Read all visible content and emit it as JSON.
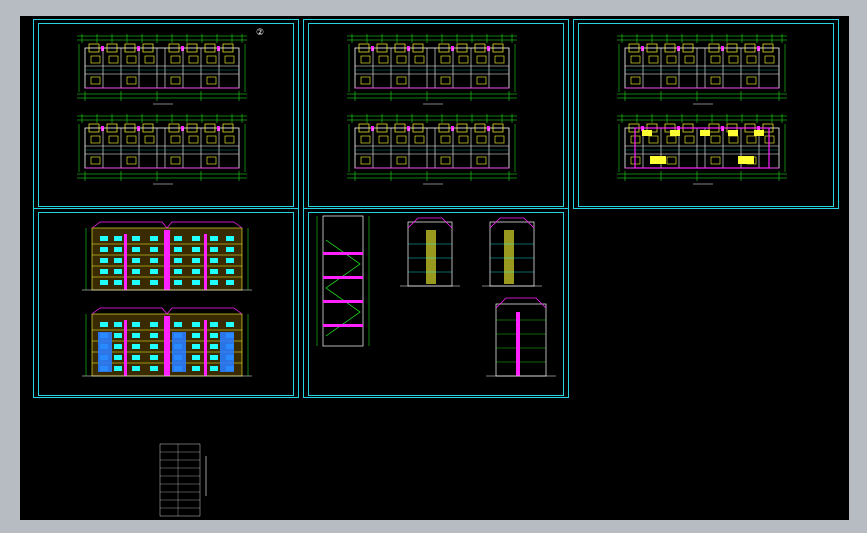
{
  "sheets": [
    {
      "id": "floor-plans-1",
      "kind": "plans"
    },
    {
      "id": "floor-plans-2",
      "kind": "plans"
    },
    {
      "id": "floor-plans-3",
      "kind": "plans"
    },
    {
      "id": "elevations",
      "kind": "elevations"
    },
    {
      "id": "sections",
      "kind": "sections"
    }
  ],
  "colors": {
    "background": "#000000",
    "frame": "#27d3e0",
    "wall": "#ffffff",
    "dimension": "#22ff22",
    "accent_yellow": "#ffff33",
    "accent_magenta": "#ff22ff",
    "accent_cyan": "#22ffff",
    "window_blue": "#2a7dff",
    "app_chrome": "#b7bcc3"
  },
  "drawing_marker": "②"
}
